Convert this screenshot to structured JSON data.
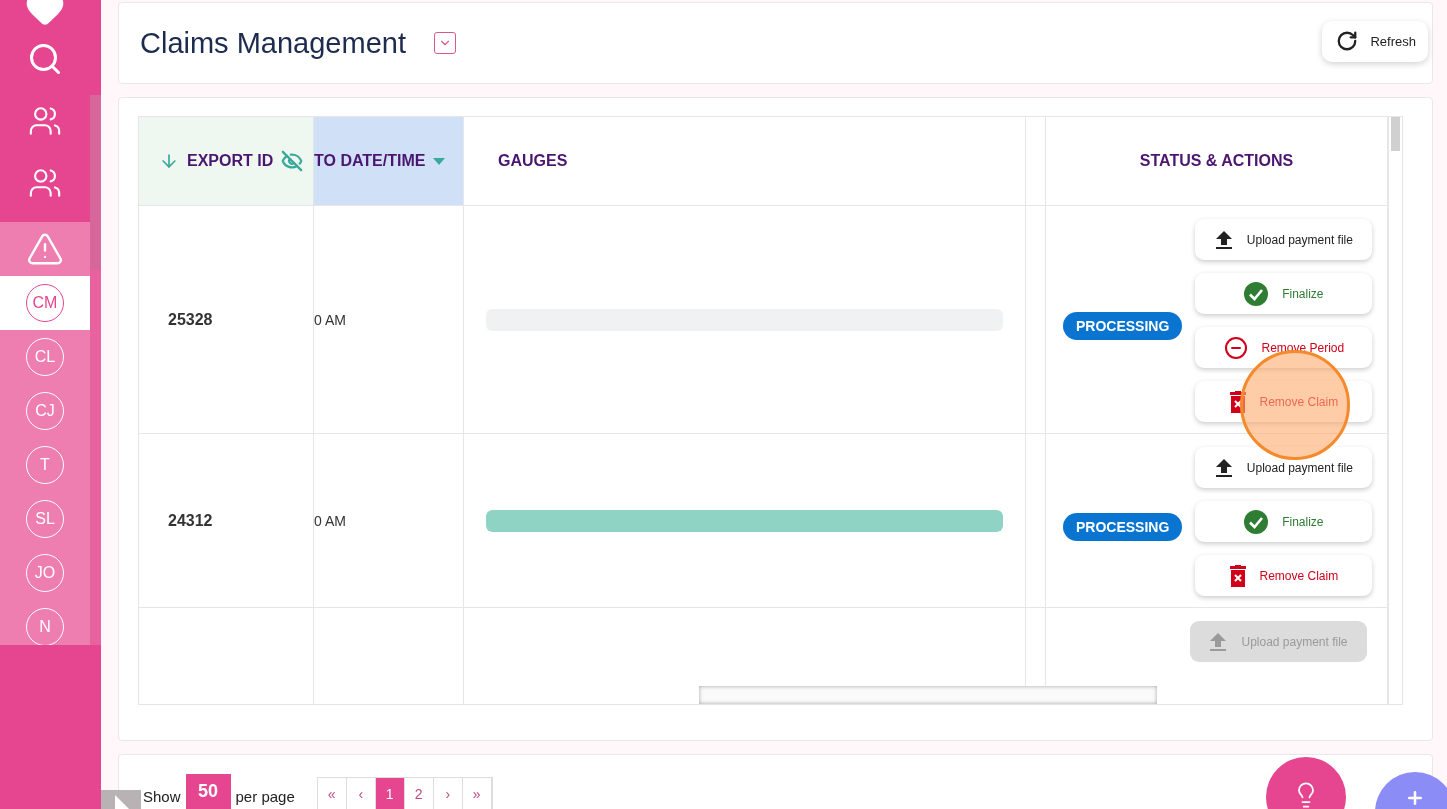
{
  "sidebar": {
    "items": [
      {
        "initials": "CM",
        "selected": true
      },
      {
        "initials": "CL",
        "selected": false
      },
      {
        "initials": "CJ",
        "selected": false
      },
      {
        "initials": "T",
        "selected": false
      },
      {
        "initials": "SL",
        "selected": false
      },
      {
        "initials": "JO",
        "selected": false
      },
      {
        "initials": "N",
        "selected": false
      }
    ]
  },
  "header": {
    "title": "Claims Management",
    "refresh": "Refresh"
  },
  "table": {
    "columns": [
      "EXPORT ID",
      "TO DATE/TIME",
      "GAUGES",
      "STATUS & ACTIONS"
    ],
    "rows": [
      {
        "export_id": "25328",
        "date": "0 AM",
        "gauge": {
          "level": 0
        },
        "status": {
          "kind": "processing",
          "label": "PROCESSING"
        },
        "actions": [
          {
            "kind": "upload",
            "label": "Upload payment file",
            "disabled": false
          },
          {
            "kind": "finalize",
            "label": "Finalize",
            "disabled": false
          },
          {
            "kind": "remove-period",
            "label": "Remove Period",
            "disabled": false
          },
          {
            "kind": "remove-claim",
            "label": "Remove Claim",
            "disabled": false
          }
        ]
      },
      {
        "export_id": "24312",
        "date": "0 AM",
        "gauge": {
          "level": 1
        },
        "status": {
          "kind": "processing",
          "label": "PROCESSING"
        },
        "actions": [
          {
            "kind": "upload",
            "label": "Upload payment file",
            "disabled": false
          },
          {
            "kind": "finalize",
            "label": "Finalize",
            "disabled": false
          },
          {
            "kind": "remove-claim",
            "label": "Remove Claim",
            "disabled": false
          }
        ]
      },
      {
        "actions": [
          {
            "kind": "upload",
            "label": "Upload payment file",
            "disabled": true
          }
        ]
      }
    ]
  },
  "footer": {
    "show": "Show",
    "page_size": "50",
    "per_page": "per page",
    "pages": [
      {
        "label": "«",
        "selected": false
      },
      {
        "label": "‹",
        "selected": false
      },
      {
        "label": "1",
        "selected": true
      },
      {
        "label": "2",
        "selected": false
      },
      {
        "label": "›",
        "selected": false
      },
      {
        "label": "»",
        "selected": false
      }
    ]
  }
}
